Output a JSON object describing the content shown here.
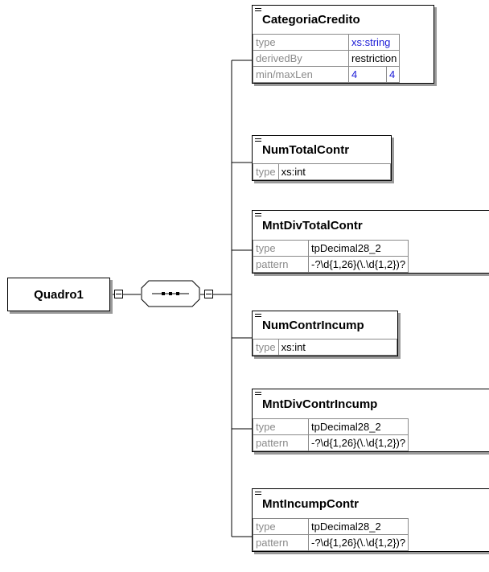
{
  "root": {
    "label": "Quadro1"
  },
  "sequence": {
    "icon": "sequence-compositor-icon"
  },
  "elements": [
    {
      "name": "CategoriaCredito",
      "rows": [
        {
          "key": "type",
          "value": "xs:string"
        },
        {
          "key": "derivedBy",
          "value": "restriction"
        },
        {
          "key": "min/maxLen",
          "min": "4",
          "max": "4"
        }
      ]
    },
    {
      "name": "NumTotalContr",
      "rows": [
        {
          "key": "type",
          "value": "xs:int"
        }
      ]
    },
    {
      "name": "MntDivTotalContr",
      "rows": [
        {
          "key": "type",
          "value": "tpDecimal28_2"
        },
        {
          "key": "pattern",
          "value": "-?\\d{1,26}(\\.\\d{1,2})?"
        }
      ]
    },
    {
      "name": "NumContrIncump",
      "rows": [
        {
          "key": "type",
          "value": "xs:int"
        }
      ]
    },
    {
      "name": "MntDivContrIncump",
      "rows": [
        {
          "key": "type",
          "value": "tpDecimal28_2"
        },
        {
          "key": "pattern",
          "value": "-?\\d{1,26}(\\.\\d{1,2})?"
        }
      ]
    },
    {
      "name": "MntIncumpContr",
      "rows": [
        {
          "key": "type",
          "value": "tpDecimal28_2"
        },
        {
          "key": "pattern",
          "value": "-?\\d{1,26}(\\.\\d{1,2})?"
        }
      ]
    }
  ],
  "colors": {
    "line": "#000000",
    "shadow": "#9a9a9a",
    "key_text": "#8a8a8a",
    "builtin_type": "#1a1ad6"
  }
}
